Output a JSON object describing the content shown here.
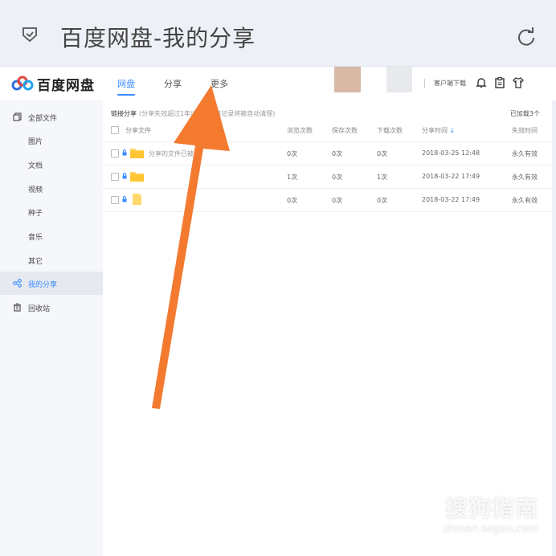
{
  "topbar": {
    "title": "百度网盘-我的分享",
    "back_icon": "shield-back-icon",
    "refresh_icon": "refresh-icon"
  },
  "header": {
    "logo_text": "百度网盘",
    "tabs": [
      {
        "label": "网盘",
        "active": true
      },
      {
        "label": "分享",
        "active": false
      },
      {
        "label": "更多",
        "active": false
      }
    ],
    "client_download": "客户端下载"
  },
  "sidebar": {
    "items": [
      {
        "label": "全部文件",
        "icon": "files-icon",
        "active": false
      },
      {
        "label": "图片",
        "active": false
      },
      {
        "label": "文档",
        "active": false
      },
      {
        "label": "视频",
        "active": false
      },
      {
        "label": "种子",
        "active": false
      },
      {
        "label": "音乐",
        "active": false
      },
      {
        "label": "其它",
        "active": false
      },
      {
        "label": "我的分享",
        "icon": "share-icon",
        "active": true
      },
      {
        "label": "回收站",
        "icon": "trash-icon",
        "active": false
      }
    ]
  },
  "main": {
    "breadcrumb": "链接分享",
    "note": "(分享失效超过1年以",
    "note2": "链记录将被自动清理)",
    "loaded": "已加载3个",
    "columns": {
      "file": "分享文件",
      "views": "浏览次数",
      "saves": "保存次数",
      "downloads": "下载次数",
      "time": "分享时间",
      "expire": "失效时间"
    },
    "rows": [
      {
        "name": "分享的文件已被",
        "views": "0次",
        "saves": "0次",
        "downloads": "0次",
        "time": "2018-03-25 12:48",
        "expire": "永久有效"
      },
      {
        "name": "",
        "views": "1次",
        "saves": "0次",
        "downloads": "1次",
        "time": "2018-03-22 17:49",
        "expire": "永久有效"
      },
      {
        "name": "",
        "views": "0次",
        "saves": "0次",
        "downloads": "0次",
        "time": "2018-03-22 17:49",
        "expire": "永久有效"
      }
    ]
  },
  "watermark": {
    "line1": "搜狗指南",
    "line2": "zhinan.sogou.com"
  },
  "colors": {
    "accent": "#3b8cff",
    "arrow": "#f47a30",
    "folder": "#ffd15c"
  }
}
